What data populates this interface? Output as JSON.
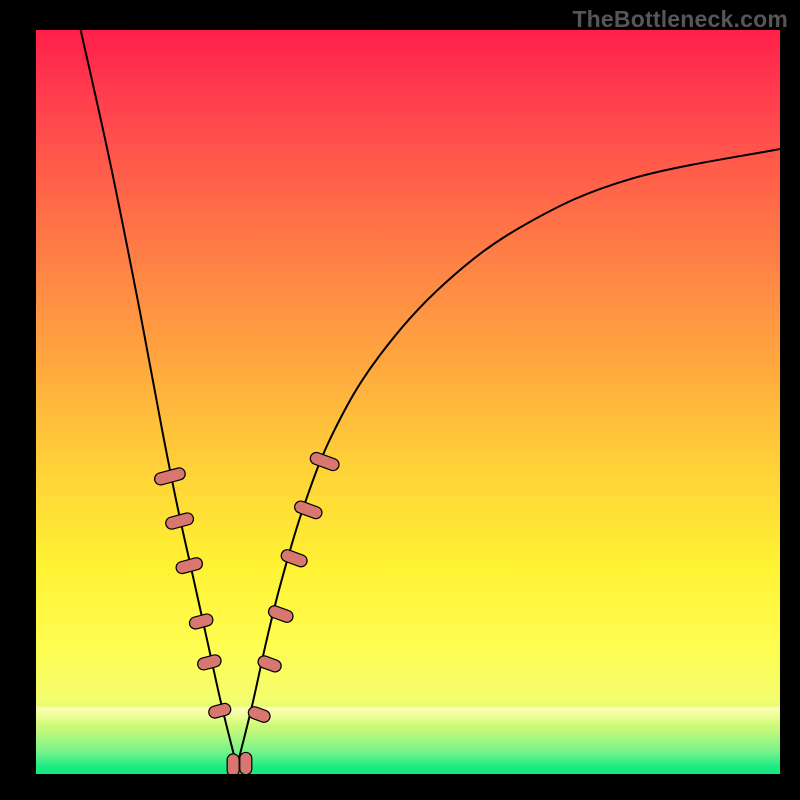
{
  "watermark": "TheBottleneck.com",
  "colors": {
    "background": "#000000",
    "bead_fill": "#d8776f",
    "bead_stroke": "#000000",
    "curve_stroke": "#000000"
  },
  "chart_data": {
    "type": "line",
    "title": "",
    "xlabel": "",
    "ylabel": "",
    "xlim": [
      0,
      100
    ],
    "ylim": [
      0,
      100
    ],
    "x_min_point": 27,
    "left_curve": {
      "x": [
        6,
        10,
        14,
        17,
        19,
        21,
        23,
        25,
        27
      ],
      "y": [
        100,
        82,
        62,
        46,
        36,
        27,
        18,
        9,
        1
      ]
    },
    "right_curve": {
      "x": [
        27,
        29,
        31,
        33,
        36,
        40,
        46,
        55,
        66,
        80,
        100
      ],
      "y": [
        1,
        9,
        18,
        26,
        36,
        46,
        56,
        66,
        74,
        80,
        84
      ]
    },
    "beads": [
      {
        "side": "left",
        "x_pct": 18.0,
        "y_pct": 40.0,
        "len": 4.2
      },
      {
        "side": "left",
        "x_pct": 19.3,
        "y_pct": 34.0,
        "len": 3.8
      },
      {
        "side": "left",
        "x_pct": 20.6,
        "y_pct": 28.0,
        "len": 3.6
      },
      {
        "side": "left",
        "x_pct": 22.2,
        "y_pct": 20.5,
        "len": 3.2
      },
      {
        "side": "left",
        "x_pct": 23.3,
        "y_pct": 15.0,
        "len": 3.2
      },
      {
        "side": "left",
        "x_pct": 24.7,
        "y_pct": 8.5,
        "len": 3.0
      },
      {
        "side": "flat",
        "x_pct": 26.5,
        "y_pct": 1.2,
        "len": 3.0
      },
      {
        "side": "flat",
        "x_pct": 28.2,
        "y_pct": 1.4,
        "len": 3.0
      },
      {
        "side": "right",
        "x_pct": 30.0,
        "y_pct": 8.0,
        "len": 3.0
      },
      {
        "side": "right",
        "x_pct": 31.4,
        "y_pct": 14.8,
        "len": 3.2
      },
      {
        "side": "right",
        "x_pct": 32.9,
        "y_pct": 21.5,
        "len": 3.4
      },
      {
        "side": "right",
        "x_pct": 34.7,
        "y_pct": 29.0,
        "len": 3.6
      },
      {
        "side": "right",
        "x_pct": 36.6,
        "y_pct": 35.5,
        "len": 3.8
      },
      {
        "side": "right",
        "x_pct": 38.8,
        "y_pct": 42.0,
        "len": 4.0
      }
    ]
  }
}
